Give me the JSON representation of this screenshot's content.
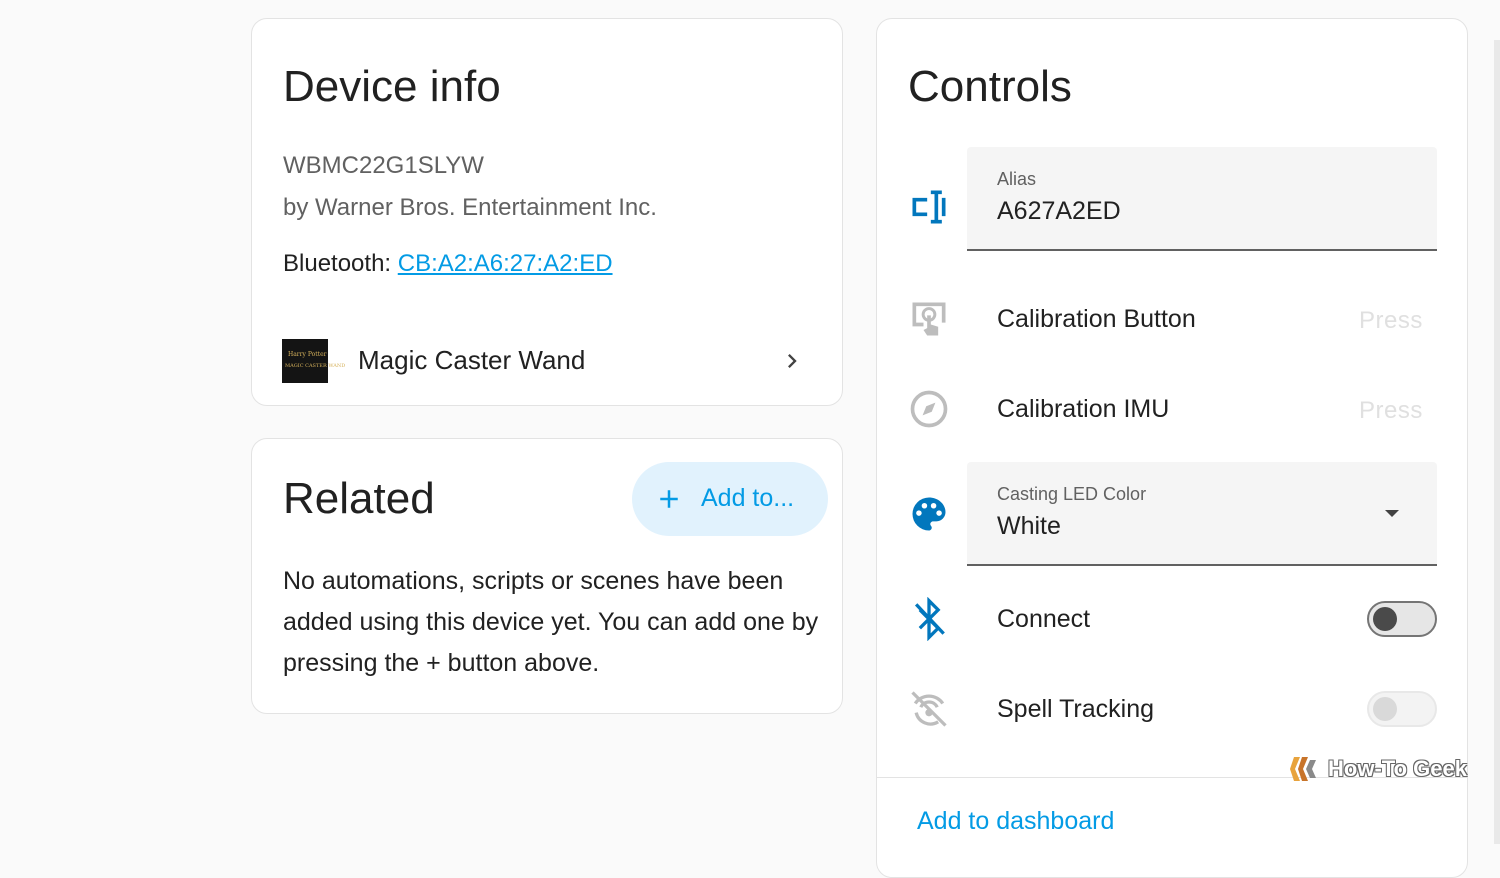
{
  "device_info": {
    "title": "Device info",
    "model": "WBMC22G1SLYW",
    "manufacturer": "by Warner Bros. Entertainment Inc.",
    "bluetooth_label": "Bluetooth: ",
    "bluetooth_address": "CB:A2:A6:27:A2:ED",
    "entity": {
      "name": "Magic Caster Wand",
      "thumb_line1": "Harry Potter",
      "thumb_line2": "MAGIC CASTER WAND",
      "chevron_icon": "chevron-right-icon"
    }
  },
  "related": {
    "title": "Related",
    "add_button_label": "Add to...",
    "add_icon": "plus-icon",
    "empty_text": "No automations, scripts or scenes have been added using this device yet. You can add one by pressing the + button above."
  },
  "controls": {
    "title": "Controls",
    "alias": {
      "label": "Alias",
      "value": "A627A2ED",
      "icon": "rename-box-icon"
    },
    "calibration_button": {
      "label": "Calibration Button",
      "action": "Press",
      "icon": "gesture-tap-button-icon"
    },
    "calibration_imu": {
      "label": "Calibration IMU",
      "action": "Press",
      "icon": "compass-icon"
    },
    "casting_led_color": {
      "label": "Casting LED Color",
      "value": "White",
      "icon": "palette-icon"
    },
    "connect": {
      "label": "Connect",
      "state": "off",
      "icon": "bluetooth-off-icon"
    },
    "spell_tracking": {
      "label": "Spell Tracking",
      "state": "off-disabled",
      "icon": "motion-sensor-off-icon"
    },
    "add_to_dashboard": "Add to dashboard"
  },
  "watermark": {
    "text": "How-To Geek"
  },
  "colors": {
    "accent": "#039be5",
    "icon": "#0277bd",
    "text": "#212121",
    "secondary_text": "#616161"
  }
}
